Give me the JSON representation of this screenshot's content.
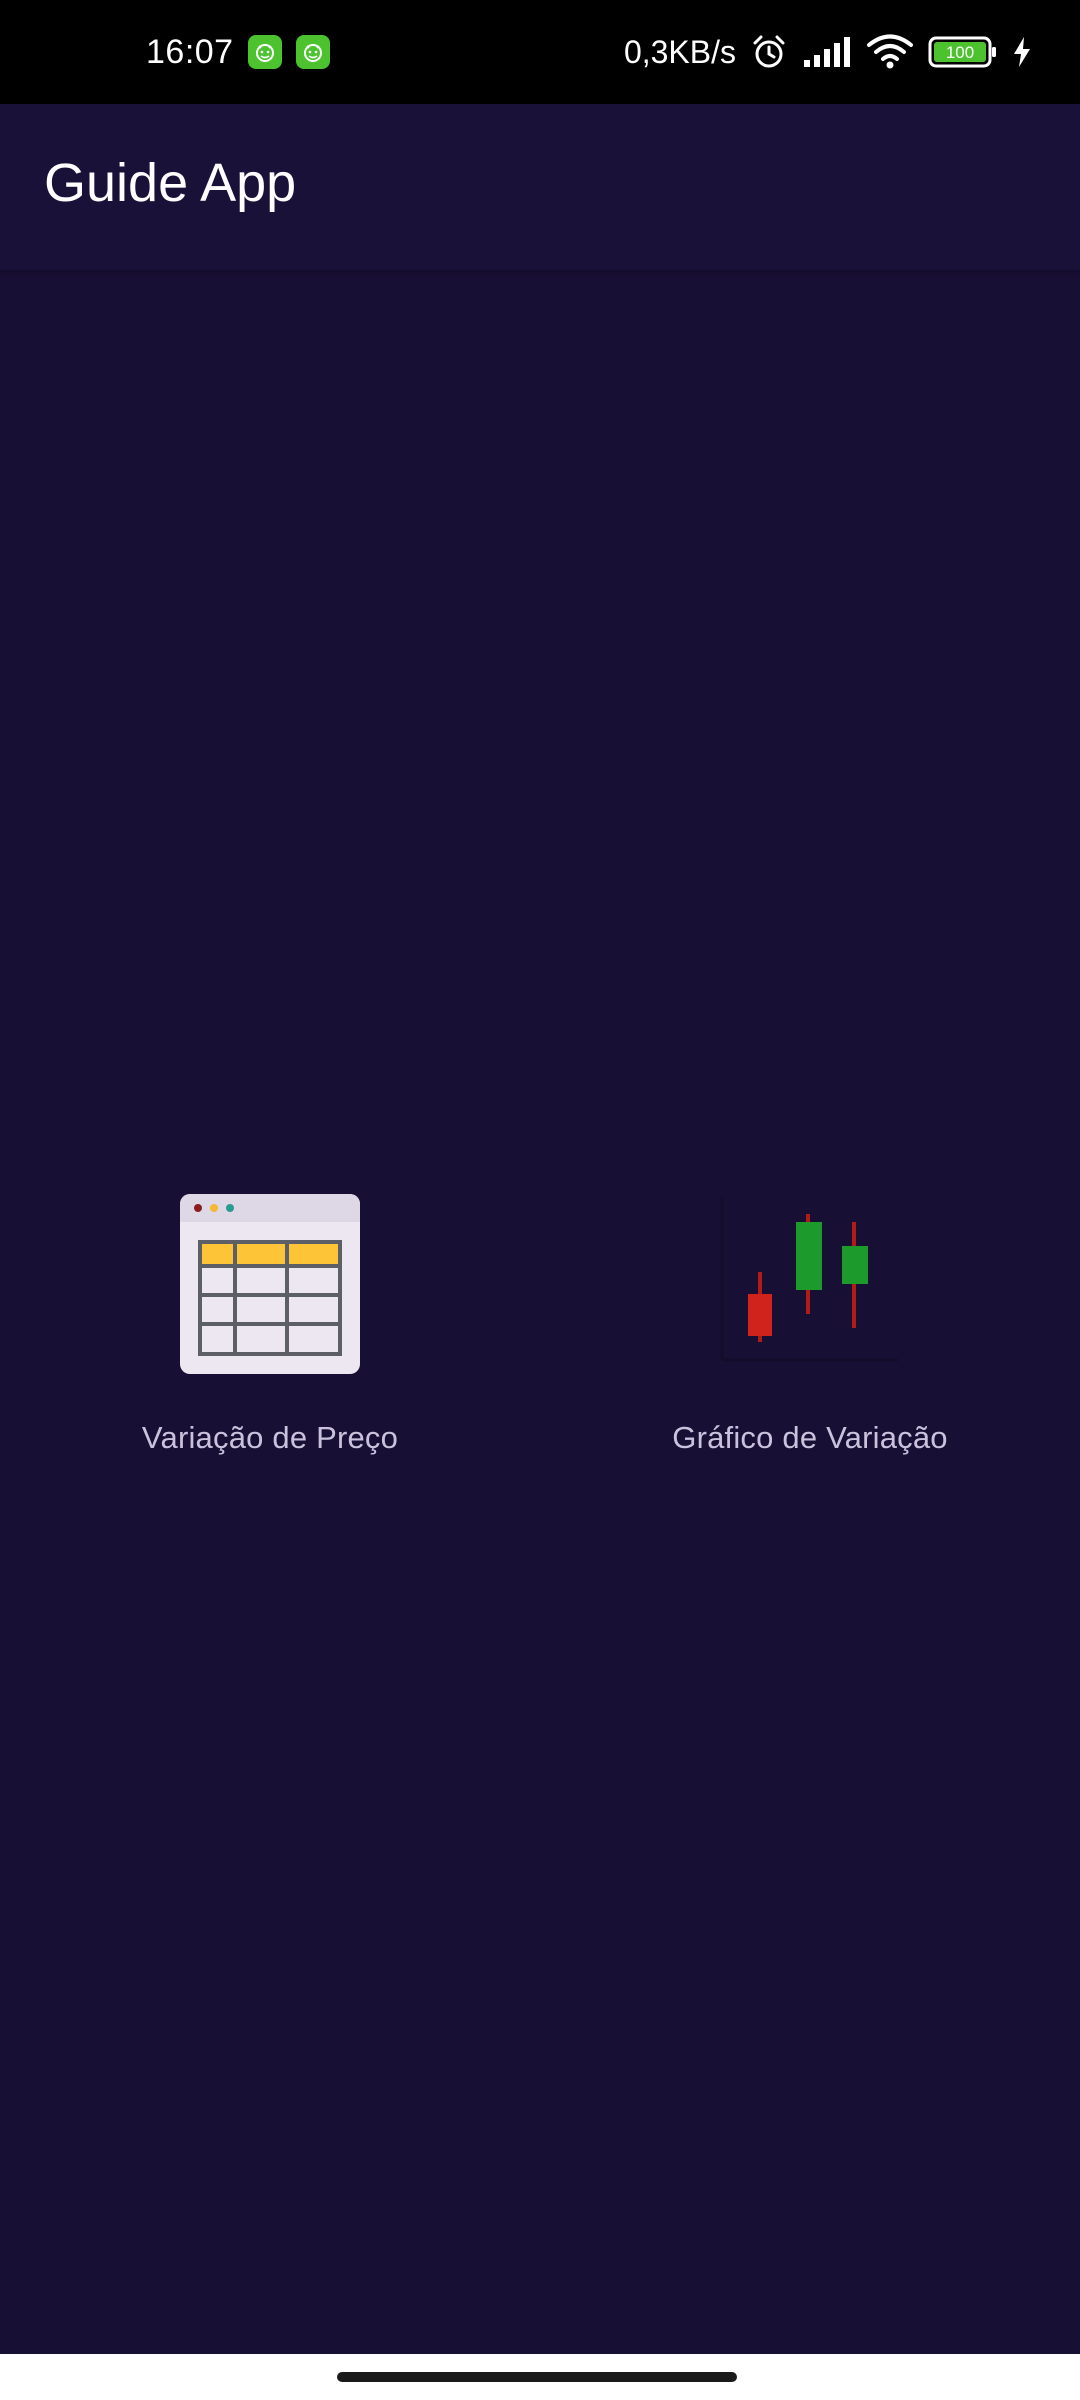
{
  "status_bar": {
    "time": "16:07",
    "net_speed": "0,3KB/s",
    "battery": "100",
    "icons": [
      "notification-app-icon",
      "notification-app-icon",
      "alarm-icon",
      "signal-icon",
      "wifi-icon",
      "battery-icon",
      "charging-icon"
    ]
  },
  "app_bar": {
    "title": "Guide App"
  },
  "menu": [
    {
      "label": "Variação de Preço",
      "icon": "price-table-icon"
    },
    {
      "label": "Gráfico de Variação",
      "icon": "candlestick-chart-icon"
    }
  ],
  "colors": {
    "background": "#180f35",
    "app_bar": "#1a1138",
    "label": "#c9c2dc",
    "table_header": "#fcc436",
    "candle_up": "#1d9a2c",
    "candle_down": "#d0231c"
  }
}
